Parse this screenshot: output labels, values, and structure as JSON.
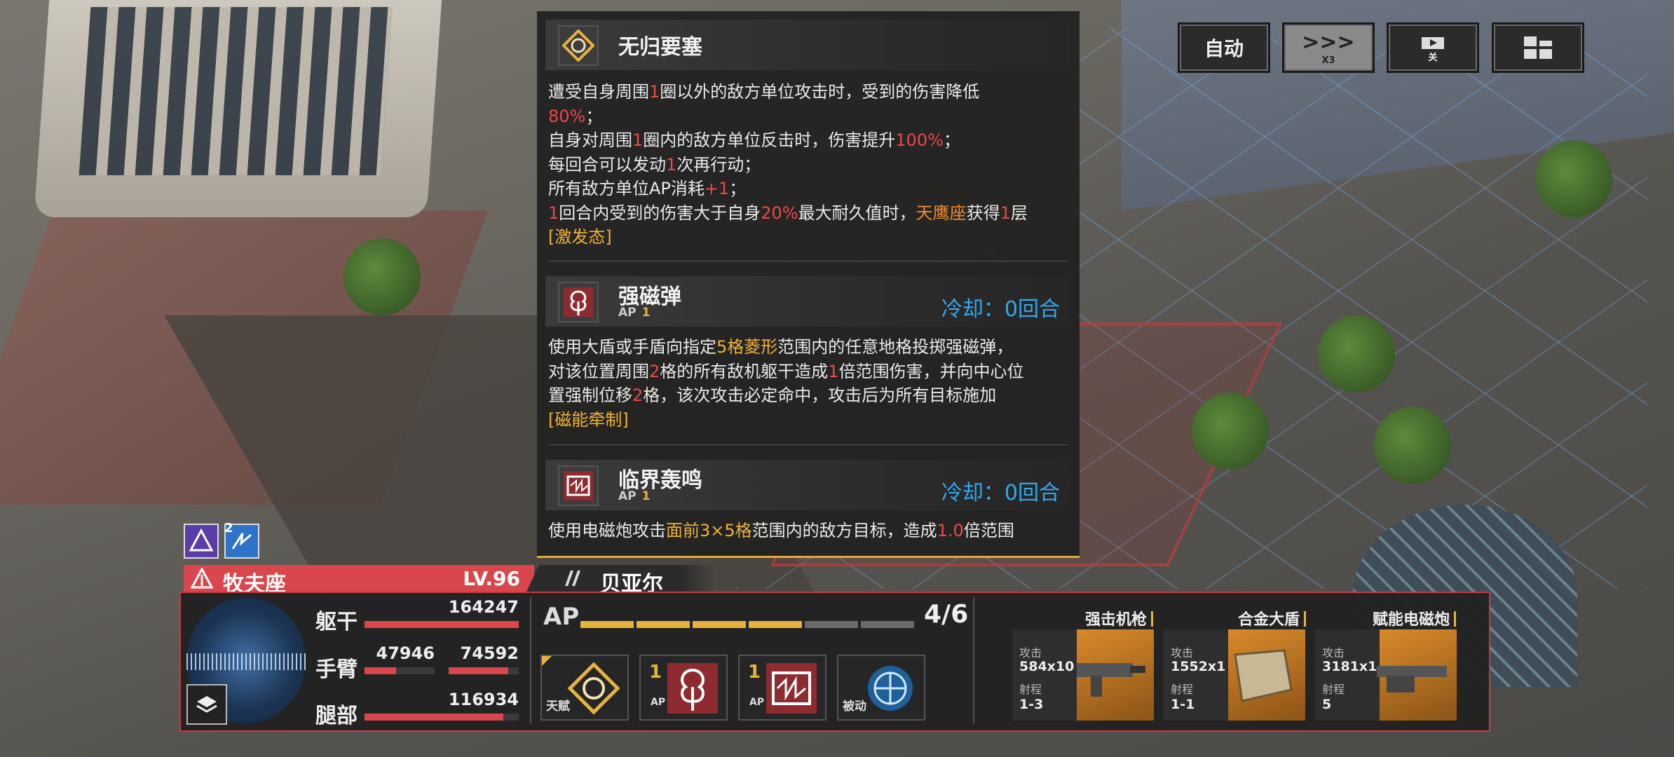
{
  "top_buttons": {
    "auto": "自动",
    "speed_icon": ">>>",
    "speed_label": "X3",
    "cinematic_label": "关",
    "menu_icon": "grid-icon"
  },
  "tooltip": {
    "talent": {
      "name": "无归要塞",
      "icon": "talent-emblem-icon",
      "desc": [
        [
          {
            "t": "遭受自身周围"
          },
          {
            "t": "1",
            "c": "red"
          },
          {
            "t": "圈以外的敌方单位攻击时，受到的伤害降低"
          }
        ],
        [
          {
            "t": "80%",
            "c": "red"
          },
          {
            "t": "；"
          }
        ],
        [
          {
            "t": "自身对周围"
          },
          {
            "t": "1",
            "c": "red"
          },
          {
            "t": "圈内的敌方单位反击时，伤害提升"
          },
          {
            "t": "100%",
            "c": "red"
          },
          {
            "t": "；"
          }
        ],
        [
          {
            "t": "每回合可以发动"
          },
          {
            "t": "1",
            "c": "red"
          },
          {
            "t": "次再行动；"
          }
        ],
        [
          {
            "t": "所有敌方单位AP消耗"
          },
          {
            "t": "+1",
            "c": "red"
          },
          {
            "t": "；"
          }
        ],
        [
          {
            "t": "1",
            "c": "red"
          },
          {
            "t": "回合内受到的伤害大于自身"
          },
          {
            "t": "20%",
            "c": "red"
          },
          {
            "t": "最大耐久值时，"
          },
          {
            "t": "天鹰座",
            "c": "orange"
          },
          {
            "t": "获得"
          },
          {
            "t": "1",
            "c": "red"
          },
          {
            "t": "层"
          }
        ],
        [
          {
            "t": "[激发态]",
            "c": "gold"
          }
        ]
      ]
    },
    "skill1": {
      "name": "强磁弹",
      "ap_label": "AP",
      "ap": "1",
      "cooldown": "冷却：0回合",
      "desc": [
        [
          {
            "t": "使用大盾或手盾向指定"
          },
          {
            "t": "5格菱形",
            "c": "gold"
          },
          {
            "t": "范围内的任意地格投掷强磁弹，"
          }
        ],
        [
          {
            "t": "对该位置周围"
          },
          {
            "t": "2",
            "c": "red"
          },
          {
            "t": "格的所有敌机躯干造成"
          },
          {
            "t": "1",
            "c": "red"
          },
          {
            "t": "倍范围伤害，并向中心位"
          }
        ],
        [
          {
            "t": "置强制位移"
          },
          {
            "t": "2",
            "c": "red"
          },
          {
            "t": "格，该次攻击必定命中，攻击后为所有目标施加"
          }
        ],
        [
          {
            "t": "[磁能牵制]",
            "c": "gold"
          }
        ]
      ]
    },
    "skill2": {
      "name": "临界轰鸣",
      "ap_label": "AP",
      "ap": "1",
      "cooldown": "冷却：0回合",
      "desc": [
        [
          {
            "t": "使用电磁炮攻击"
          },
          {
            "t": "面前3×5格",
            "c": "gold"
          },
          {
            "t": "范围内的敌方目标，造成"
          },
          {
            "t": "1.0",
            "c": "red"
          },
          {
            "t": "倍范围"
          }
        ]
      ]
    }
  },
  "unit": {
    "buff_count": "2",
    "name": "牧夫座",
    "level": "LV.96",
    "pilot": "贝亚尔",
    "hp": {
      "torso_label": "躯干",
      "torso": "164247",
      "torso_frac": 1.0,
      "arm_label": "手臂",
      "arm_left": "47946",
      "arm_left_frac": 0.45,
      "arm_right": "74592",
      "arm_right_frac": 0.85,
      "leg_label": "腿部",
      "leg": "116934",
      "leg_frac": 0.9
    },
    "ap_label": "AP",
    "ap_text": "4/6",
    "ap_current": 4,
    "ap_max": 6,
    "skills": [
      {
        "label": "天赋",
        "ap": "",
        "ap_label": "",
        "icon": "talent-emblem-icon"
      },
      {
        "label": "",
        "ap": "1",
        "ap_label": "AP",
        "icon": "magnet-bomb-icon"
      },
      {
        "label": "",
        "ap": "1",
        "ap_label": "AP",
        "icon": "railgun-icon"
      },
      {
        "label": "被动",
        "ap": "",
        "ap_label": "",
        "icon": "passive-circuit-icon"
      }
    ],
    "weapons": [
      {
        "name": "强击机枪",
        "atk_label": "攻击",
        "atk": "584x10",
        "range_label": "射程",
        "range": "1-3",
        "icon": "machine-gun-icon"
      },
      {
        "name": "合金大盾",
        "atk_label": "攻击",
        "atk": "1552x1",
        "range_label": "射程",
        "range": "1-1",
        "icon": "shield-icon"
      },
      {
        "name": "赋能电磁炮",
        "atk_label": "攻击",
        "atk": "3181x1",
        "range_label": "射程",
        "range": "5",
        "icon": "railgun-weapon-icon"
      }
    ]
  },
  "colors": {
    "accent_red": "#d9474d",
    "gold": "#e6b33c",
    "cooldown_blue": "#31a9ee",
    "tooltip_bg": "#222222"
  }
}
